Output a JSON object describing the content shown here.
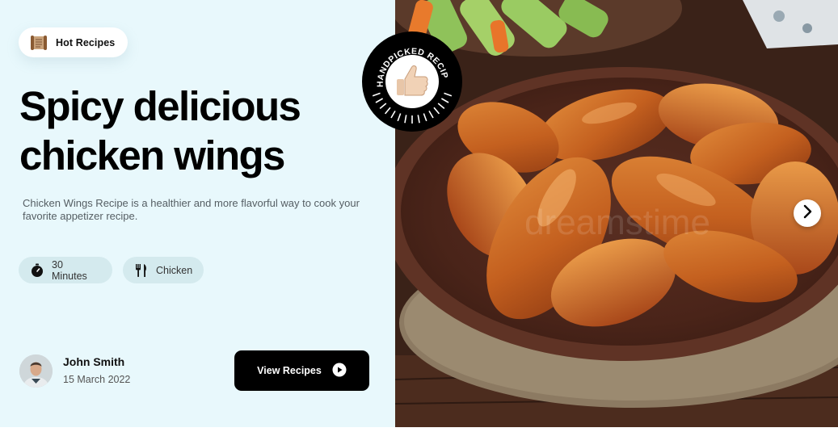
{
  "badge": {
    "label": "Hot Recipes",
    "icon": "scroll-icon"
  },
  "recipe": {
    "title_line1": "Spicy delicious",
    "title_line2": "chicken wings",
    "description": "Chicken Wings Recipe is a healthier and more flavorful way to cook your favorite appetizer recipe.",
    "time": {
      "label": "30 Minutes",
      "icon": "timer-icon"
    },
    "category": {
      "label": "Chicken",
      "icon": "fork-knife-icon"
    }
  },
  "author": {
    "name": "John Smith",
    "date": "15 March 2022"
  },
  "actions": {
    "view_label": "View Recipes",
    "view_icon": "play-circle-icon",
    "next_icon": "chevron-right-icon"
  },
  "stamp": {
    "text": "HANDPICKED RECIPES",
    "icon": "thumbs-up-icon"
  },
  "photo": {
    "watermark": "dreamstime"
  },
  "colors": {
    "background": "#e8f8fc",
    "chip": "#d4eaee",
    "button": "#000000",
    "text": "#000000"
  }
}
